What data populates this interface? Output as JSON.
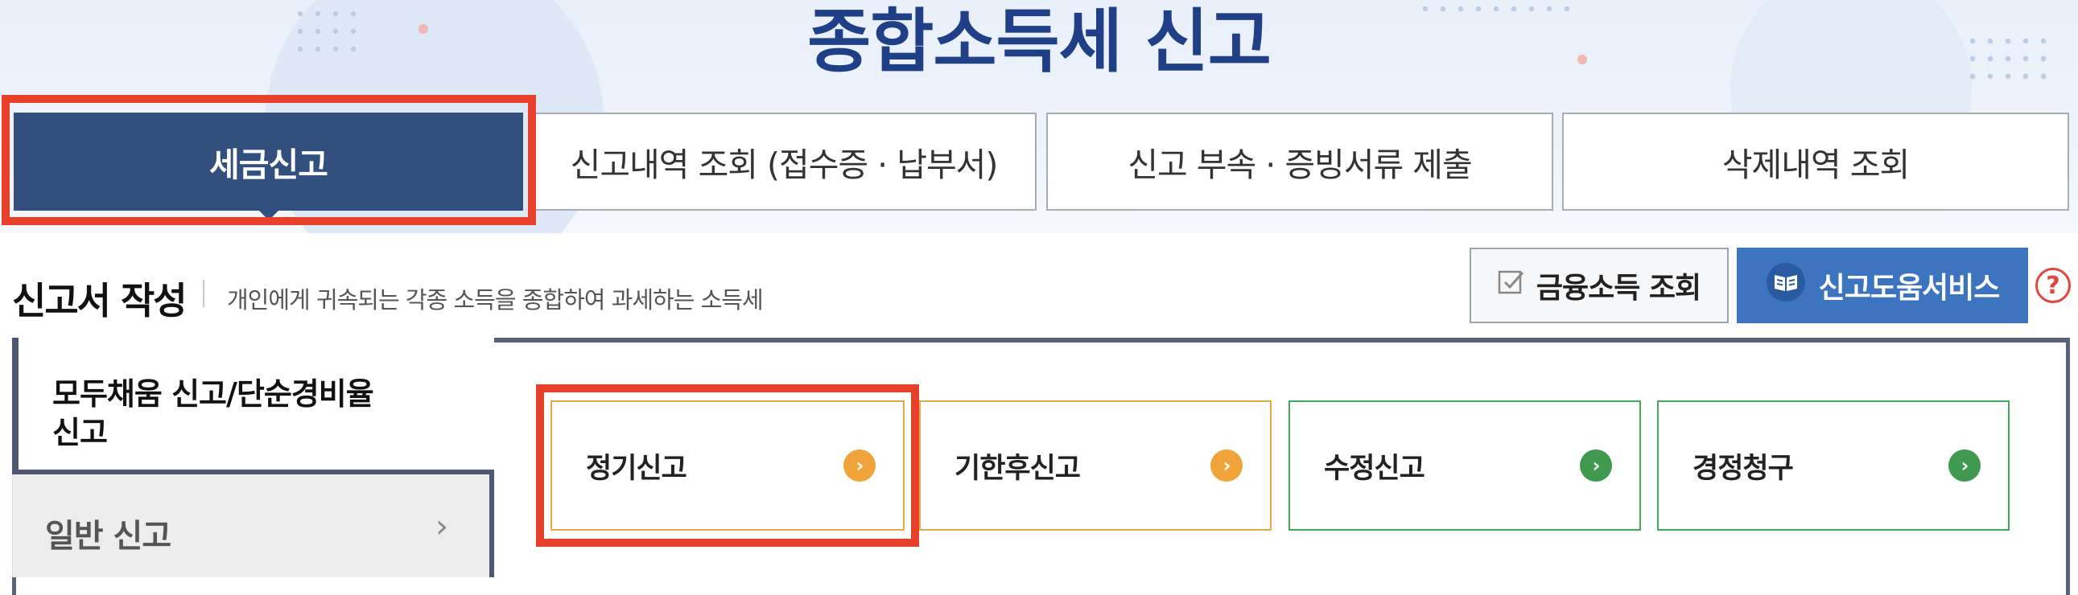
{
  "header": {
    "title": "종합소득세 신고"
  },
  "tabs": [
    {
      "label": "세금신고",
      "active": true
    },
    {
      "label": "신고내역 조회 (접수증 · 납부서)",
      "active": false
    },
    {
      "label": "신고 부속 · 증빙서류 제출",
      "active": false
    },
    {
      "label": "삭제내역 조회",
      "active": false
    }
  ],
  "section": {
    "title": "신고서 작성",
    "description": "개인에게 귀속되는 각종 소득을 종합하여 과세하는 소득세"
  },
  "actions": {
    "financial_income_label": "금융소득 조회",
    "help_service_label": "신고도움서비스",
    "question_mark": "?"
  },
  "sidebar": {
    "items": [
      {
        "label": "모두채움 신고/단순경비율 신고",
        "selected": true
      },
      {
        "label": "일반 신고",
        "selected": false,
        "chevron": "›"
      }
    ]
  },
  "filing_options": [
    {
      "label": "정기신고",
      "icon": "arrow-right-icon",
      "icon_glyph": "›",
      "color": "#f0a43a"
    },
    {
      "label": "기한후신고",
      "icon": "arrow-right-icon",
      "icon_glyph": "›",
      "color": "#f0a43a"
    },
    {
      "label": "수정신고",
      "icon": "arrow-right-icon",
      "icon_glyph": "›",
      "color": "#3f9a4f"
    },
    {
      "label": "경정청구",
      "icon": "arrow-right-icon",
      "icon_glyph": "›",
      "color": "#3f9a4f"
    }
  ],
  "colors": {
    "title": "#1f3f87",
    "active_tab": "#31507d",
    "help_button": "#3d74c0",
    "highlight": "#e8412b"
  }
}
